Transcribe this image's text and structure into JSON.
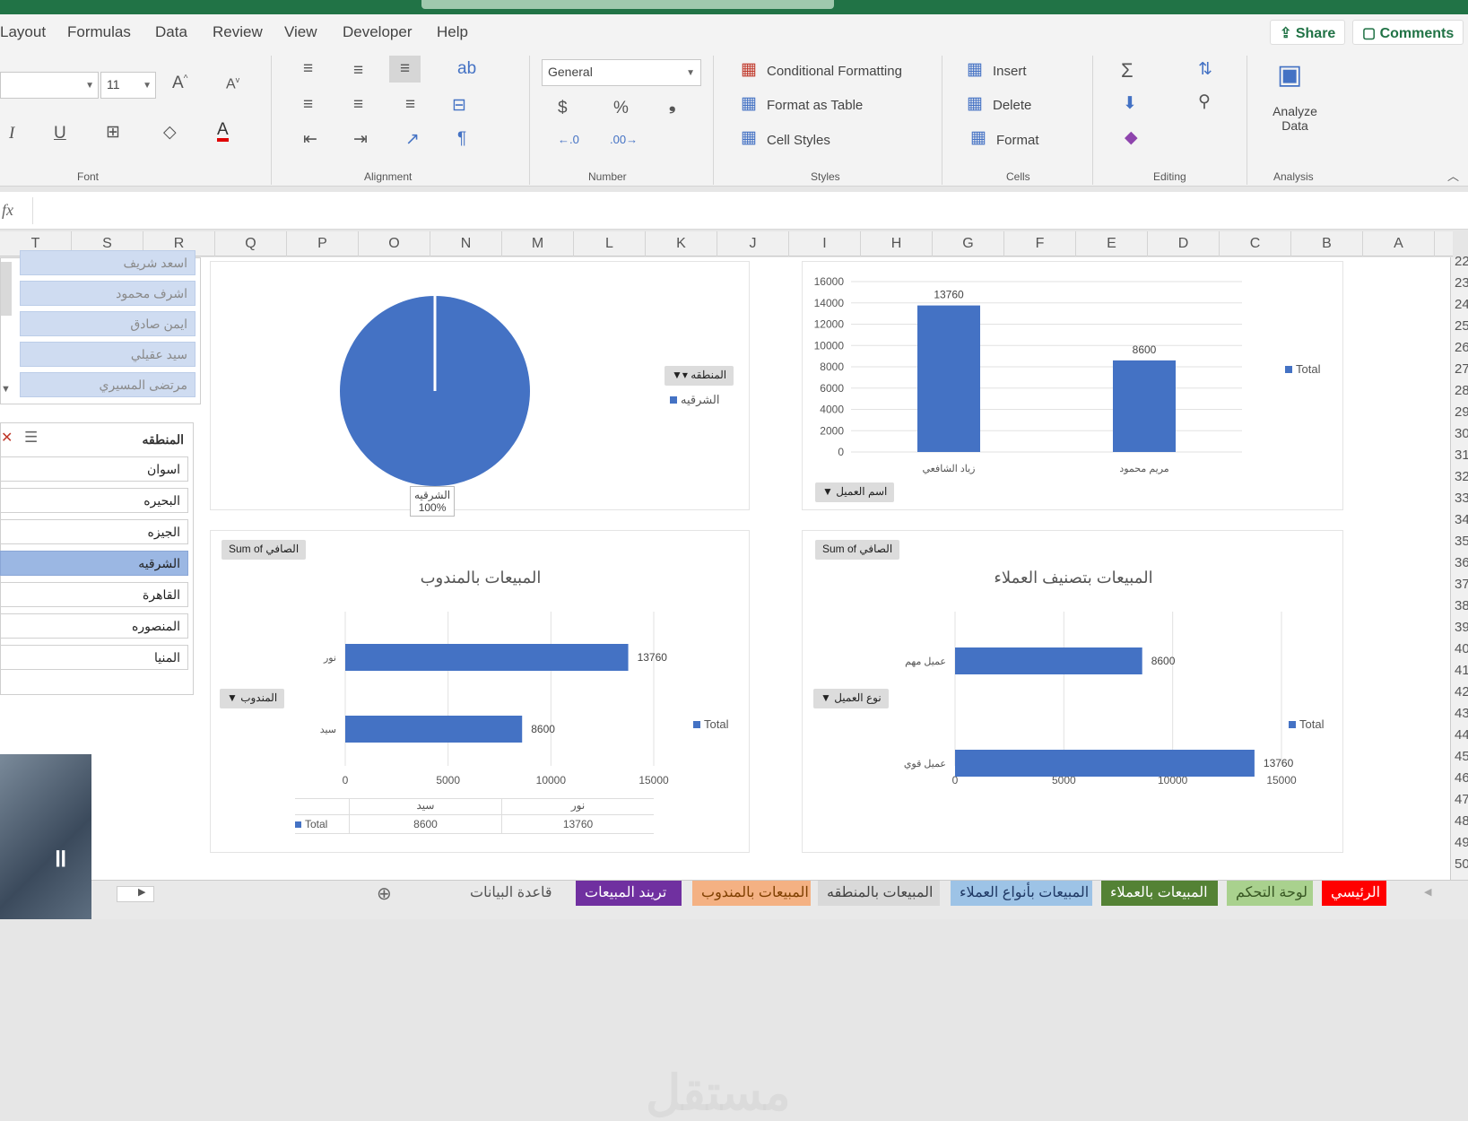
{
  "menu_tabs": [
    "Layout",
    "Formulas",
    "Data",
    "Review",
    "View",
    "Developer",
    "Help"
  ],
  "share_label": "Share",
  "comments_label": "Comments",
  "ribbon": {
    "font_size": "11",
    "number_format": "General",
    "conditional_formatting": "Conditional Formatting",
    "format_as_table": "Format as Table",
    "cell_styles": "Cell Styles",
    "insert": "Insert",
    "delete": "Delete",
    "format": "Format",
    "analyze_data": "Analyze Data",
    "groups": [
      "Font",
      "Alignment",
      "Number",
      "Styles",
      "Cells",
      "Editing",
      "Analysis"
    ]
  },
  "formula_bar": {
    "fx": "fx",
    "value": ""
  },
  "columns": [
    "T",
    "S",
    "R",
    "Q",
    "P",
    "O",
    "N",
    "M",
    "L",
    "K",
    "J",
    "I",
    "H",
    "G",
    "F",
    "E",
    "D",
    "C",
    "B",
    "A"
  ],
  "rows": [
    "22",
    "23",
    "24",
    "25",
    "26",
    "27",
    "28",
    "29",
    "30",
    "31",
    "32",
    "33",
    "34",
    "35",
    "36",
    "37",
    "38",
    "39",
    "40",
    "41",
    "42",
    "43",
    "44",
    "45",
    "46",
    "47",
    "48",
    "49",
    "50"
  ],
  "slicer_top": {
    "items": [
      "اسعد شريف",
      "اشرف محمود",
      "ايمن صادق",
      "سيد عقيلي",
      "مرتضى المسيري"
    ]
  },
  "slicer_region": {
    "title": "المنطقه",
    "items": [
      "اسوان",
      "البحيره",
      "الجيزه",
      "الشرقيه",
      "القاهرة",
      "المنصوره",
      "المنيا"
    ],
    "selected": "الشرقيه"
  },
  "pie_chart": {
    "filter_button": "المنطقه",
    "legend": "الشرقيه",
    "label_name": "الشرقيه",
    "label_pct": "100%"
  },
  "customer_bar_chart": {
    "legend": "Total",
    "field_button": "اسم العميل",
    "color": "#4472c4"
  },
  "rep_chart": {
    "field_button": "Sum of الصافي",
    "title": "المبيعات بالمندوب",
    "axis_button": "المندوب",
    "legend": "Total",
    "table_header": [
      "",
      "سيد",
      "نور"
    ],
    "table_row": [
      "Total",
      "8600",
      "13760"
    ]
  },
  "class_chart": {
    "field_button": "Sum of الصافي",
    "title": "المبيعات بتصنيف العملاء",
    "axis_button": "نوع العميل",
    "legend": "Total"
  },
  "chart_data": [
    {
      "type": "pie",
      "categories": [
        "الشرقيه"
      ],
      "values": [
        100
      ],
      "legend": "right",
      "data_labels": [
        "الشرقيه",
        "100%"
      ]
    },
    {
      "type": "bar",
      "categories": [
        "زياد الشافعي",
        "مريم محمود"
      ],
      "series": [
        {
          "name": "Total",
          "values": [
            13760,
            8600
          ]
        }
      ],
      "yticks": [
        "0",
        "2000",
        "4000",
        "6000",
        "8000",
        "10000",
        "12000",
        "14000",
        "16000"
      ],
      "ylim": [
        0,
        16000
      ],
      "grid": true,
      "legend": "right"
    },
    {
      "type": "bar",
      "orientation": "horizontal",
      "title": "المبيعات بالمندوب",
      "categories": [
        "نور",
        "سيد"
      ],
      "series": [
        {
          "name": "Total",
          "values": [
            13760,
            8600
          ]
        }
      ],
      "xticks": [
        "0",
        "5000",
        "10000",
        "15000"
      ],
      "xlim": [
        0,
        15000
      ],
      "grid": true,
      "legend": "right"
    },
    {
      "type": "bar",
      "orientation": "horizontal",
      "title": "المبيعات بتصنيف العملاء",
      "categories": [
        "عميل مهم",
        "عميل قوي"
      ],
      "series": [
        {
          "name": "Total",
          "values": [
            8600,
            13760
          ]
        }
      ],
      "xticks": [
        "0",
        "5000",
        "10000",
        "15000"
      ],
      "xlim": [
        0,
        15000
      ],
      "grid": true,
      "legend": "right"
    }
  ],
  "sheet_tabs": [
    {
      "label": "قاعدة البيانات",
      "color": "#e9e9e9",
      "text": "#555555"
    },
    {
      "label": "تريند المبيعات",
      "color": "#7030a0",
      "text": "#ffffff"
    },
    {
      "label": "المبيعات بالمندوب",
      "color": "#f4b183",
      "text": "#7f3f00"
    },
    {
      "label": "المبيعات بالمنطقه",
      "color": "#d9d9d9",
      "text": "#444444"
    },
    {
      "label": "المبيعات بأنواع العملاء",
      "color": "#9dc3e6",
      "text": "#1f3864"
    },
    {
      "label": "المبيعات بالعملاء",
      "color": "#548235",
      "text": "#ffffff"
    },
    {
      "label": "لوحة التحكم",
      "color": "#a9d18e",
      "text": "#385723"
    },
    {
      "label": "الرئيسي",
      "color": "#ff0000",
      "text": "#ffffff"
    }
  ],
  "watermark": "مستقل"
}
